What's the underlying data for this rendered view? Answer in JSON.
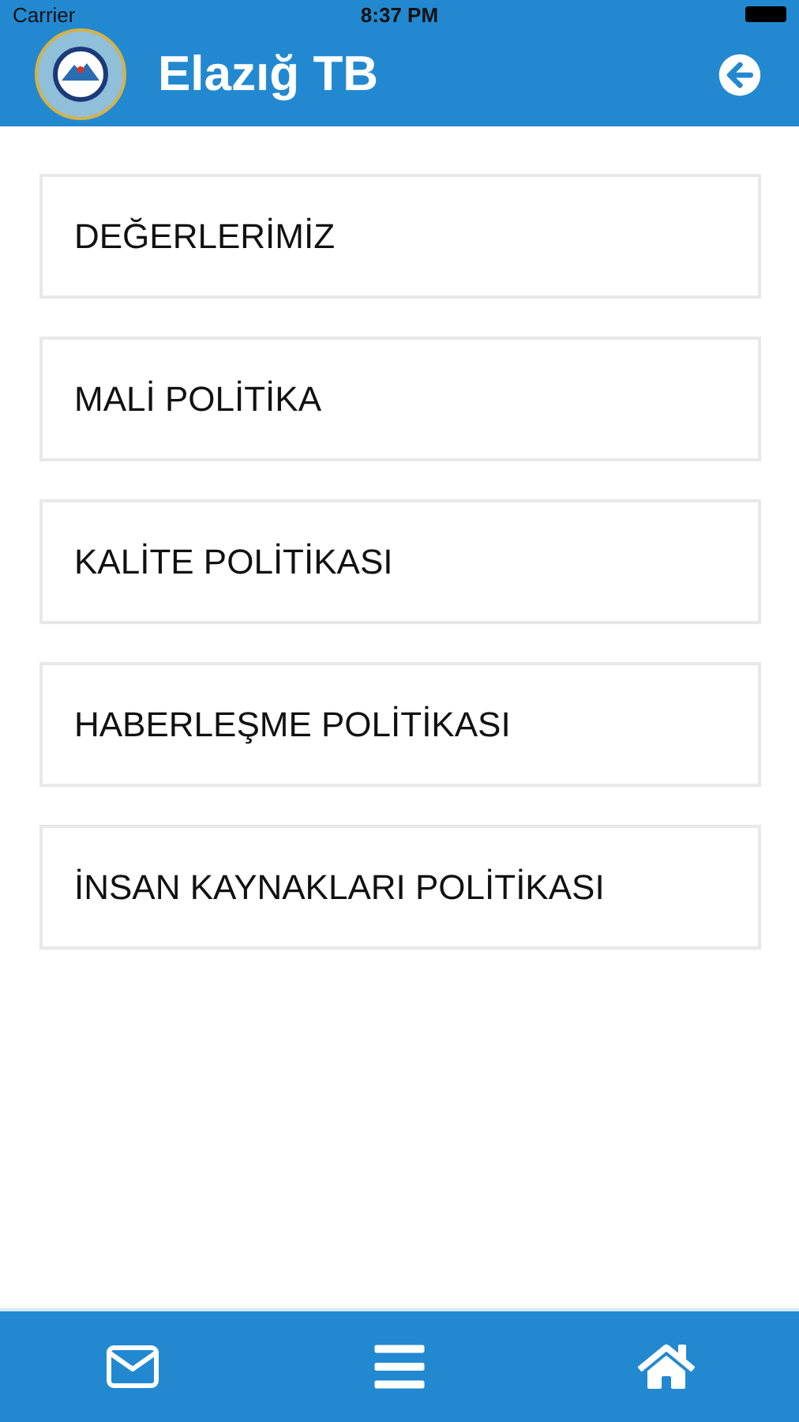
{
  "status_bar": {
    "carrier": "Carrier",
    "time": "8:37 PM"
  },
  "header": {
    "title": "Elazığ TB"
  },
  "menu_items": [
    {
      "label": "DEĞERLERİMİZ"
    },
    {
      "label": "MALİ POLİTİKA"
    },
    {
      "label": "KALİTE POLİTİKASI"
    },
    {
      "label": "HABERLEŞME POLİTİKASI"
    },
    {
      "label": "İNSAN KAYNAKLARI POLİTİKASI"
    }
  ],
  "tab_bar": [
    {
      "kind": "mail"
    },
    {
      "kind": "menu"
    },
    {
      "kind": "home"
    }
  ]
}
